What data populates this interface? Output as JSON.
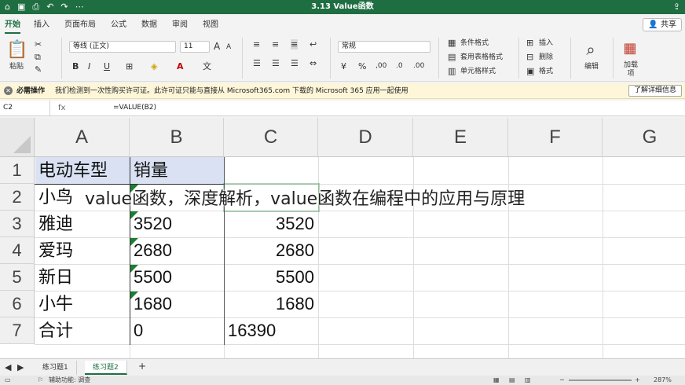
{
  "window": {
    "title": "3.13 Value函数",
    "quick_access": [
      "⌂",
      "▣",
      "⎙",
      "↶",
      "↷",
      "⋯"
    ],
    "share_icon": "share-icon"
  },
  "ribbon_tabs": [
    "开始",
    "插入",
    "页面布局",
    "公式",
    "数据",
    "审阅",
    "视图"
  ],
  "share_label": "共享",
  "ribbon": {
    "paste_label": "粘贴",
    "font_name": "等线 (正文)",
    "font_size": "11",
    "bold": "B",
    "italic": "I",
    "underline": "U",
    "font_grow": "A",
    "font_shrink": "A",
    "number_format": "常规",
    "currency": "%",
    "cond_format": "条件格式",
    "table_format": "套用表格格式",
    "cell_style": "单元格样式",
    "insert": "插入",
    "delete": "删除",
    "format": "格式",
    "edit": "编辑",
    "addins": "加载项"
  },
  "message_bar": {
    "title": "必需操作",
    "text": "我们检测到一次性购买许可证。此许可证只能与直接从 Microsoft365.com 下载的 Microsoft 365 应用一起使用",
    "button": "了解详细信息"
  },
  "formula_bar": {
    "name_box": "C2",
    "fx": "fx",
    "formula": "=VALUE(B2)"
  },
  "columns": [
    "A",
    "B",
    "C",
    "D",
    "E",
    "F",
    "G"
  ],
  "rows": [
    "1",
    "2",
    "3",
    "4",
    "5",
    "6",
    "7"
  ],
  "cells": {
    "A1": "电动车型",
    "B1": "销量",
    "A2": "小鸟",
    "B2": "",
    "C2": "",
    "A3": "雅迪",
    "B3": "3520",
    "C3": "3520",
    "A4": "爱玛",
    "B4": "2680",
    "C4": "2680",
    "A5": "新日",
    "B5": "5500",
    "C5": "5500",
    "A6": "小牛",
    "B6": "1680",
    "C6": "1680",
    "A7": "合计",
    "B7": "0",
    "C7": "16390"
  },
  "overlay_text": "value函数，深度解析，value函数在编程中的应用与原理",
  "sheets": [
    "练习题1",
    "练习题2"
  ],
  "add_sheet": "+",
  "status": {
    "left": "辅助功能: 调查",
    "zoom": "287%"
  }
}
